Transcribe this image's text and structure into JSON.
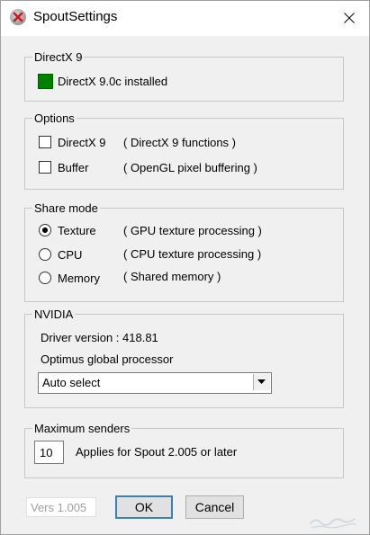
{
  "window": {
    "title": "SpoutSettings",
    "app_icon": "red-x-on-grey-circle-icon",
    "close_icon": "close-icon"
  },
  "directx": {
    "legend": "DirectX 9",
    "status_text": "DirectX 9.0c installed",
    "status_color": "#008000"
  },
  "options": {
    "legend": "Options",
    "items": [
      {
        "label": "DirectX 9",
        "description": "( DirectX 9 functions )",
        "checked": false
      },
      {
        "label": "Buffer",
        "description": "( OpenGL pixel buffering )",
        "checked": false
      }
    ]
  },
  "share_mode": {
    "legend": "Share mode",
    "items": [
      {
        "label": "Texture",
        "description": "( GPU texture processing )",
        "selected": true
      },
      {
        "label": "CPU",
        "description": "( CPU texture processing )",
        "selected": false
      },
      {
        "label": "Memory",
        "description": "( Shared memory )",
        "selected": false
      }
    ]
  },
  "nvidia": {
    "legend": "NVIDIA",
    "driver_version": "Driver version : 418.81",
    "processor_label": "Optimus global processor",
    "processor_selected": "Auto select"
  },
  "senders": {
    "legend": "Maximum senders",
    "value": "10",
    "note": "Applies for Spout 2.005 or later"
  },
  "footer": {
    "version": "Vers 1.005",
    "ok_label": "OK",
    "cancel_label": "Cancel"
  }
}
